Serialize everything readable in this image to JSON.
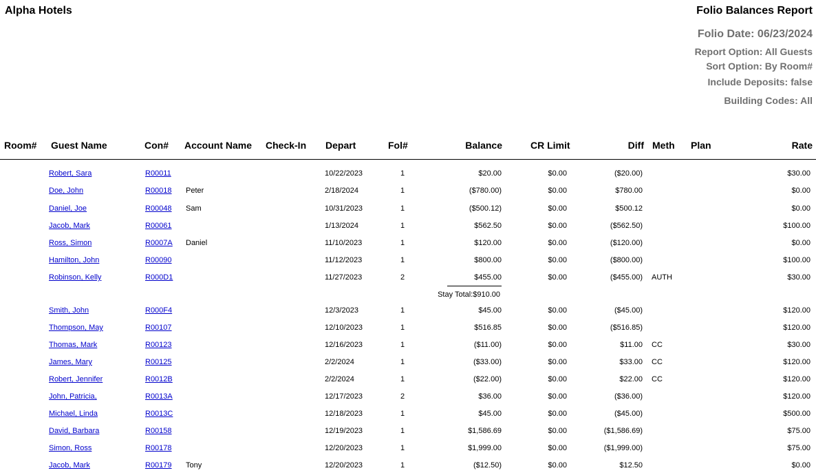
{
  "report": {
    "hotel_name": "Alpha Hotels",
    "title": "Folio Balances Report",
    "folio_date": "Folio Date: 06/23/2024",
    "report_option": "Report Option: All Guests",
    "sort_option": "Sort Option: By Room#",
    "include_deposits": "Include Deposits: false",
    "building_codes": "Building Codes: All"
  },
  "headers": {
    "room": "Room#",
    "guest": "Guest Name",
    "con": "Con#",
    "account": "Account Name",
    "checkin": "Check-In",
    "depart": "Depart",
    "fol": "Fol#",
    "balance": "Balance",
    "cr_limit": "CR Limit",
    "diff": "Diff",
    "meth": "Meth",
    "plan": "Plan",
    "rate": "Rate"
  },
  "rows": [
    {
      "guest": "Robert, Sara",
      "con": "R00011",
      "account": "",
      "depart": "10/22/2023",
      "fol": "1",
      "balance": "$20.00",
      "cr": "$0.00",
      "diff": "($20.00)",
      "meth": "",
      "rate": "$30.00"
    },
    {
      "guest": "Doe, John",
      "con": "R00018",
      "account": "Peter",
      "depart": "2/18/2024",
      "fol": "1",
      "balance": "($780.00)",
      "cr": "$0.00",
      "diff": "$780.00",
      "meth": "",
      "rate": "$0.00"
    },
    {
      "guest": "Daniel, Joe",
      "con": "R00048",
      "account": "Sam",
      "depart": "10/31/2023",
      "fol": "1",
      "balance": "($500.12)",
      "cr": "$0.00",
      "diff": "$500.12",
      "meth": "",
      "rate": "$0.00"
    },
    {
      "guest": "Jacob, Mark",
      "con": "R00061",
      "account": "",
      "depart": "1/13/2024",
      "fol": "1",
      "balance": "$562.50",
      "cr": "$0.00",
      "diff": "($562.50)",
      "meth": "",
      "rate": "$100.00"
    },
    {
      "guest": "Ross, Simon",
      "con": "R0007A",
      "account": "Daniel",
      "depart": "11/10/2023",
      "fol": "1",
      "balance": "$120.00",
      "cr": "$0.00",
      "diff": "($120.00)",
      "meth": "",
      "rate": "$0.00"
    },
    {
      "guest": "Hamilton, John",
      "con": "R00090",
      "account": "",
      "depart": "11/12/2023",
      "fol": "1",
      "balance": "$800.00",
      "cr": "$0.00",
      "diff": "($800.00)",
      "meth": "",
      "rate": "$100.00"
    },
    {
      "guest": "Robinson, Kelly",
      "con": "R000D1",
      "account": "",
      "depart": "11/27/2023",
      "fol": "2",
      "balance": "$455.00",
      "cr": "$0.00",
      "diff": "($455.00)",
      "meth": "AUTH",
      "rate": "$30.00"
    },
    {
      "guest": "Smith, John",
      "con": "R000F4",
      "account": "",
      "depart": "12/3/2023",
      "fol": "1",
      "balance": "$45.00",
      "cr": "$0.00",
      "diff": "($45.00)",
      "meth": "",
      "rate": "$120.00"
    },
    {
      "guest": "Thompson, May",
      "con": "R00107",
      "account": "",
      "depart": "12/10/2023",
      "fol": "1",
      "balance": "$516.85",
      "cr": "$0.00",
      "diff": "($516.85)",
      "meth": "",
      "rate": "$120.00"
    },
    {
      "guest": "Thomas, Mark",
      "con": "R00123",
      "account": "",
      "depart": "12/16/2023",
      "fol": "1",
      "balance": "($11.00)",
      "cr": "$0.00",
      "diff": "$11.00",
      "meth": "CC",
      "rate": "$30.00"
    },
    {
      "guest": "James, Mary",
      "con": "R00125",
      "account": "",
      "depart": "2/2/2024",
      "fol": "1",
      "balance": "($33.00)",
      "cr": "$0.00",
      "diff": "$33.00",
      "meth": "CC",
      "rate": "$120.00"
    },
    {
      "guest": "Robert, Jennifer",
      "con": "R0012B",
      "account": "",
      "depart": "2/2/2024",
      "fol": "1",
      "balance": "($22.00)",
      "cr": "$0.00",
      "diff": "$22.00",
      "meth": "CC",
      "rate": "$120.00"
    },
    {
      "guest": "John, Patricia,",
      "con": "R0013A",
      "account": "",
      "depart": "12/17/2023",
      "fol": "2",
      "balance": "$36.00",
      "cr": "$0.00",
      "diff": "($36.00)",
      "meth": "",
      "rate": "$120.00"
    },
    {
      "guest": "Michael, Linda",
      "con": "R0013C",
      "account": "",
      "depart": "12/18/2023",
      "fol": "1",
      "balance": "$45.00",
      "cr": "$0.00",
      "diff": "($45.00)",
      "meth": "",
      "rate": "$500.00"
    },
    {
      "guest": "David, Barbara",
      "con": "R00158",
      "account": "",
      "depart": "12/19/2023",
      "fol": "1",
      "balance": "$1,586.69",
      "cr": "$0.00",
      "diff": "($1,586.69)",
      "meth": "",
      "rate": "$75.00"
    },
    {
      "guest": "Simon, Ross",
      "con": "R00178",
      "account": "",
      "depart": "12/20/2023",
      "fol": "1",
      "balance": "$1,999.00",
      "cr": "$0.00",
      "diff": "($1,999.00)",
      "meth": "",
      "rate": "$75.00"
    },
    {
      "guest": "Jacob, Mark",
      "con": "R00179",
      "account": "Tony",
      "depart": "12/20/2023",
      "fol": "1",
      "balance": "($12.50)",
      "cr": "$0.00",
      "diff": "$12.50",
      "meth": "",
      "rate": "$0.00"
    }
  ],
  "stay_total": "Stay Total:$910.00"
}
